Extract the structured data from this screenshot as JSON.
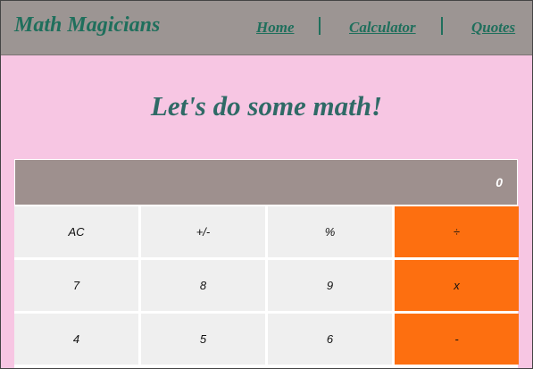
{
  "navbar": {
    "brand": "Math Magicians",
    "links": [
      {
        "label": "Home"
      },
      {
        "label": "Calculator"
      },
      {
        "label": "Quotes"
      }
    ]
  },
  "main": {
    "heading": "Let's do some math!"
  },
  "calculator": {
    "display": "0",
    "keys": [
      [
        "AC",
        "+/-",
        "%",
        "÷"
      ],
      [
        "7",
        "8",
        "9",
        "x"
      ],
      [
        "4",
        "5",
        "6",
        "-"
      ]
    ]
  },
  "colors": {
    "page_background": "#f7c6e3",
    "navbar_background": "#9c9593",
    "brand_text": "#1f6f5c",
    "heading_text": "#2f6a66",
    "display_background": "#9e908e",
    "key_background": "#efefef",
    "operator_key_background": "#fd6f10"
  }
}
